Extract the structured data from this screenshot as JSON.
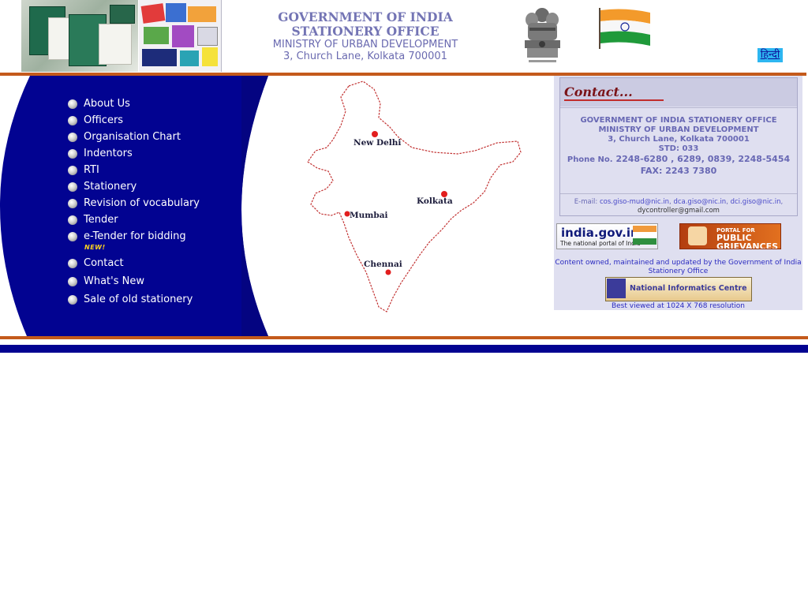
{
  "header": {
    "title": "GOVERNMENT OF INDIA STATIONERY OFFICE",
    "ministry": "MINISTRY OF URBAN DEVELOPMENT",
    "address": "3, Church Lane, Kolkata 700001",
    "hindi_link": "हिन्दी",
    "emblem_icon": "state-emblem-icon",
    "flag_icon": "india-flag-icon"
  },
  "nav": {
    "items": [
      {
        "label": "About Us"
      },
      {
        "label": "Officers"
      },
      {
        "label": "Organisation Chart"
      },
      {
        "label": "Indentors"
      },
      {
        "label": "RTI"
      },
      {
        "label": "Stationery"
      },
      {
        "label": "Revision of vocabulary"
      },
      {
        "label": "Tender"
      },
      {
        "label": "e-Tender for bidding",
        "badge": "NEW!"
      },
      {
        "label": "Contact"
      },
      {
        "label": "What's New"
      },
      {
        "label": "Sale of old stationery"
      }
    ]
  },
  "map": {
    "cities": [
      "New Delhi",
      "Kolkata",
      "Mumbai",
      "Chennai"
    ]
  },
  "contact": {
    "heading": "Contact...",
    "org": "GOVERNMENT OF INDIA STATIONERY OFFICE",
    "ministry": "MINISTRY OF URBAN DEVELOPMENT",
    "address": "3, Church Lane, Kolkata 700001",
    "std": "STD: 033",
    "phone_label": "Phone No.",
    "phone_numbers": "2248-6280 , 6289, 0839, 2248-5454",
    "fax": "FAX: 2243 7380",
    "email_label": "E-mail:",
    "email1": "cos.giso-mud@nic.in",
    "email2": "dca.giso@nic.in",
    "email3": "dci.giso@nic.in",
    "email4": "dycontroller@gmail.com"
  },
  "banners": {
    "india_portal_title": "india.gov.in",
    "india_portal_sub": "The national portal of India",
    "grievance_line1": "PORTAL FOR",
    "grievance_line2": "PUBLIC GRIEVANCES"
  },
  "footer": {
    "owned": "Content owned, maintained and updated by the Government of India Stationery Office",
    "nic": "National Informatics Centre",
    "best_view": "Best viewed at 1024 X 768 resolution"
  },
  "colors": {
    "nav_bg": "#020391",
    "accent_rule": "#c45a1b",
    "title": "#7374b4",
    "contact_panel": "#dfdff0"
  }
}
